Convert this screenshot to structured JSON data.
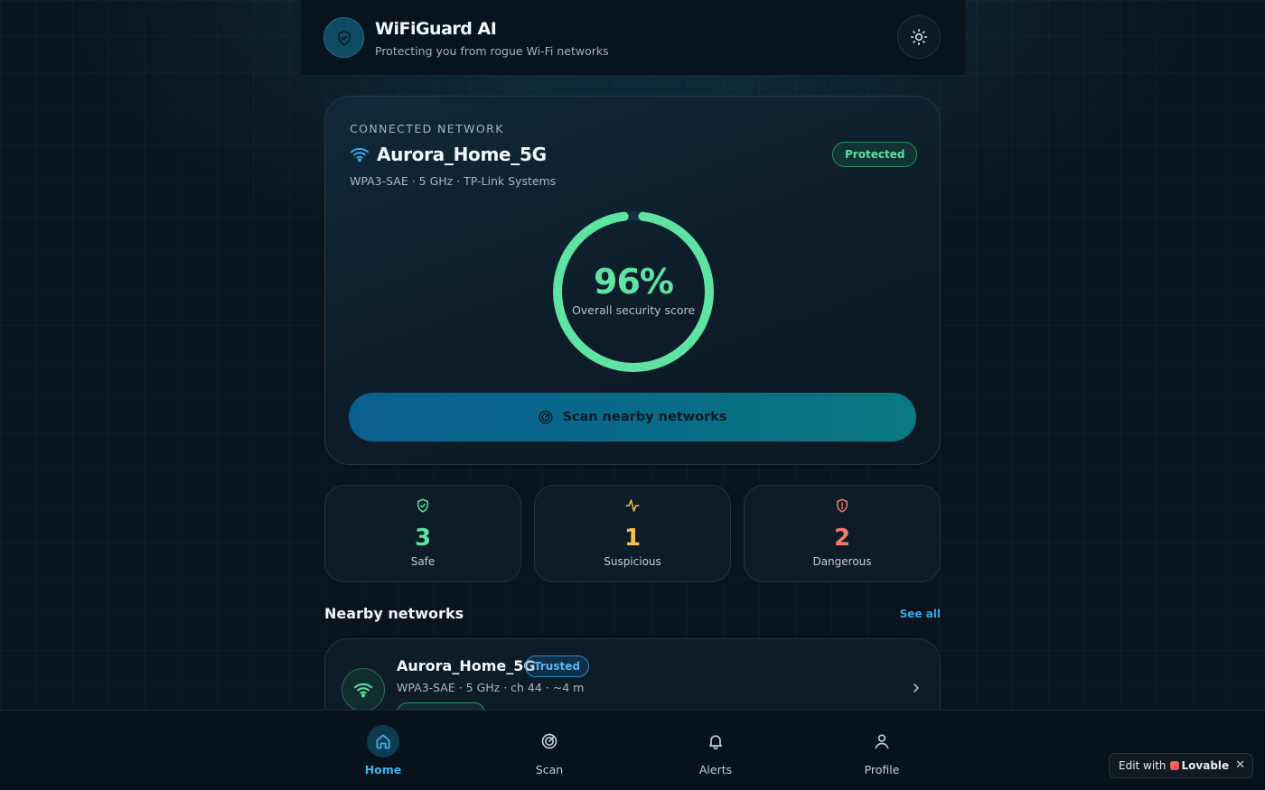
{
  "header": {
    "title": "WiFiGuard AI",
    "subtitle": "Protecting you from rogue Wi-Fi networks"
  },
  "connected": {
    "eyebrow": "CONNECTED NETWORK",
    "name": "Aurora_Home_5G",
    "meta": "WPA3-SAE · 5 GHz · TP-Link Systems",
    "status": "Protected",
    "score_text": "96%",
    "score_value": 96,
    "score_label": "Overall security score",
    "scan_label": "Scan nearby networks"
  },
  "stats": [
    {
      "count": "3",
      "label": "Safe",
      "color": "#5ee3a2",
      "icon": "shield-check-icon"
    },
    {
      "count": "1",
      "label": "Suspicious",
      "color": "#f4c04e",
      "icon": "activity-icon"
    },
    {
      "count": "2",
      "label": "Dangerous",
      "color": "#f3796b",
      "icon": "shield-alert-icon"
    }
  ],
  "nearby": {
    "title": "Nearby networks",
    "see_all": "See all",
    "items": [
      {
        "name": "Aurora_Home_5G",
        "badge": "Trusted",
        "meta": "WPA3-SAE · 5 GHz · ch 44 · ~4 m"
      }
    ]
  },
  "nav": {
    "items": [
      {
        "label": "Home",
        "active": true
      },
      {
        "label": "Scan",
        "active": false
      },
      {
        "label": "Alerts",
        "active": false
      },
      {
        "label": "Profile",
        "active": false
      }
    ]
  },
  "lovable": {
    "prefix": "Edit with",
    "brand": "Lovable",
    "close": "✕"
  },
  "colors": {
    "accent": "#3db4f0",
    "safe": "#5ee3a2",
    "warn": "#f4c04e",
    "danger": "#f3796b"
  }
}
